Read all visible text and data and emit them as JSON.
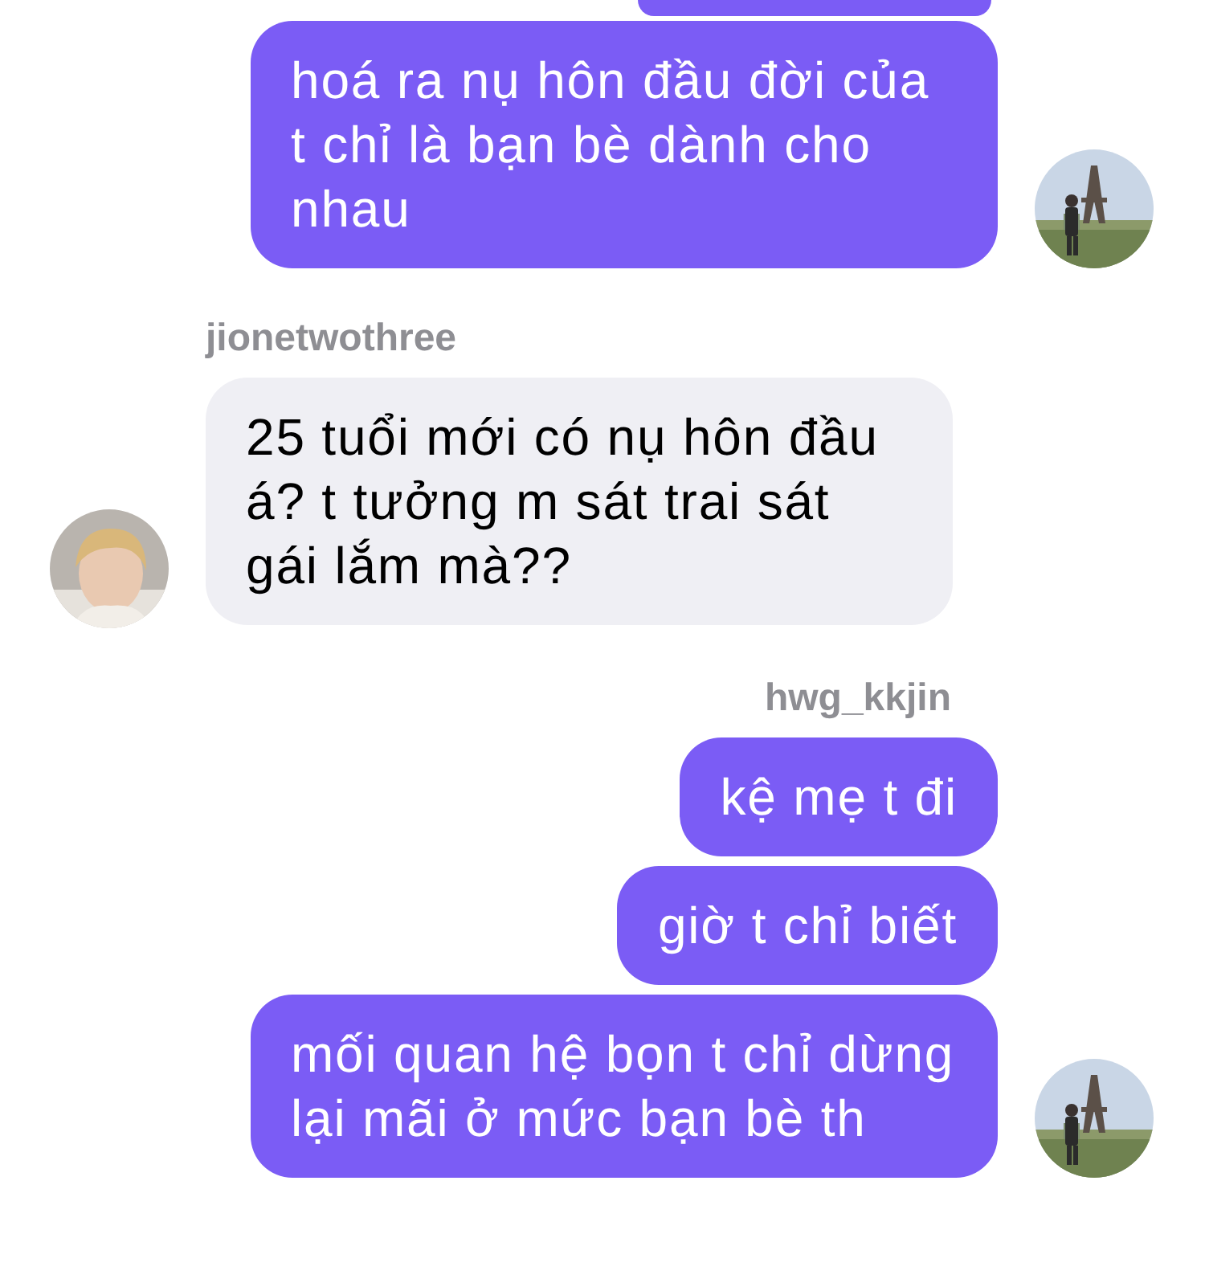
{
  "groups": [
    {
      "kind": "outgoing",
      "clipped_top": true,
      "messages": [
        "hoá ra nụ hôn đầu đời của t chỉ là bạn bè dành cho nhau"
      ]
    },
    {
      "kind": "incoming",
      "sender": "jionetwothree",
      "messages": [
        "25 tuổi mới có nụ hôn đầu á? t tưởng m sát trai sát gái lắm mà??"
      ]
    },
    {
      "kind": "outgoing",
      "sender": "hwg_kkjin",
      "messages": [
        "kệ mẹ t đi",
        "giờ t chỉ biết",
        "mối quan hệ bọn t chỉ dừng lại mãi ở mức bạn bè th"
      ]
    }
  ]
}
